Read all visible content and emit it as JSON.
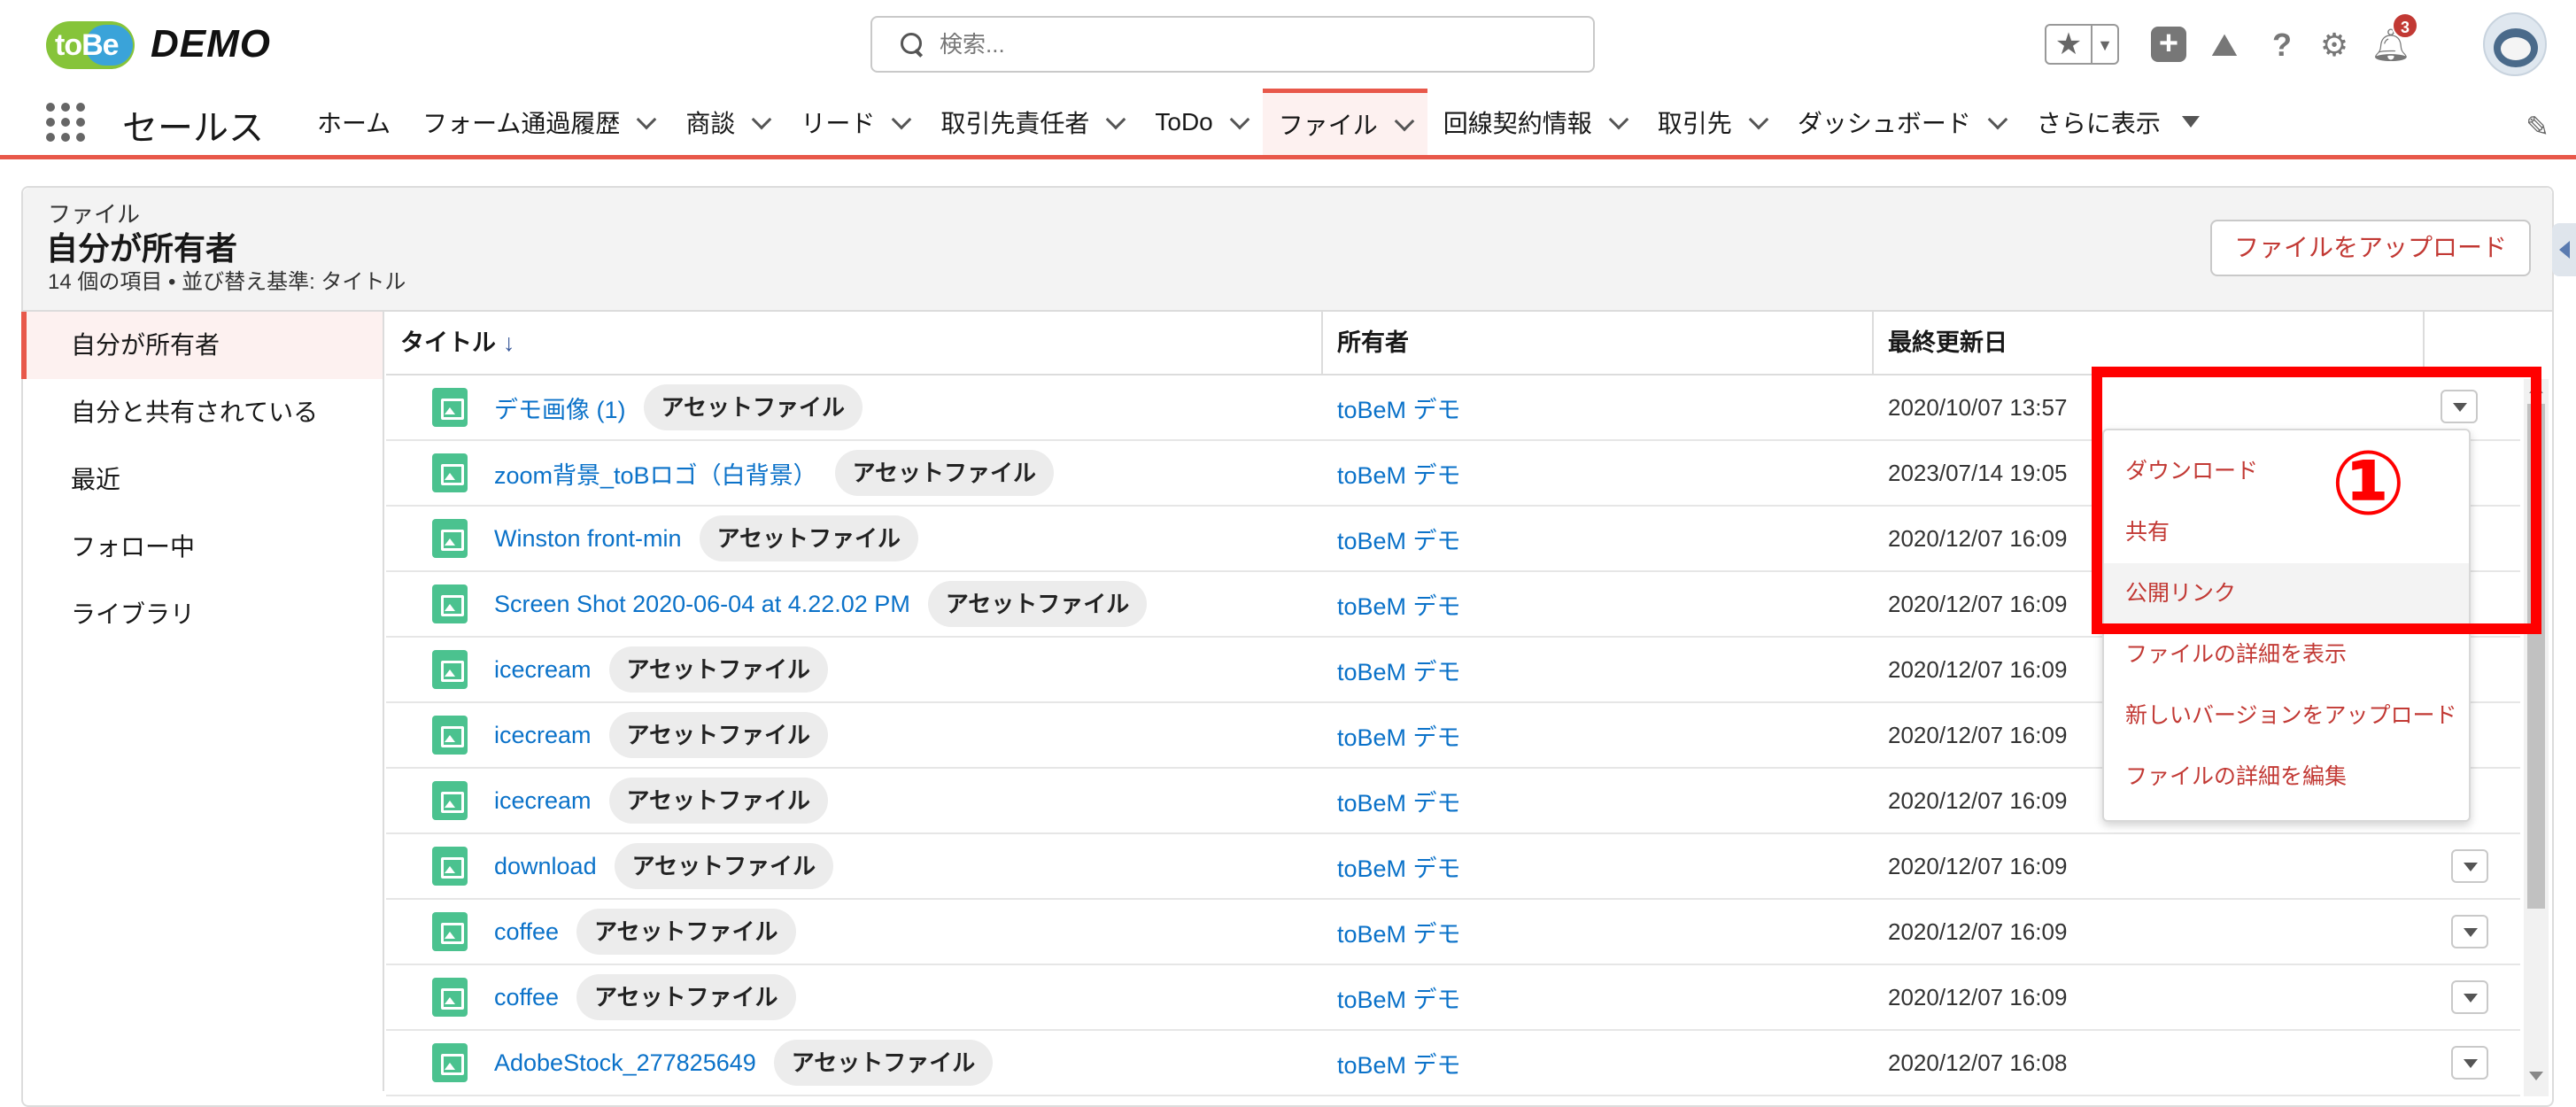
{
  "header": {
    "logo_badge": "toBe",
    "logo_text": "DEMO",
    "search_placeholder": "検索...",
    "notification_count": "3"
  },
  "nav": {
    "app_name": "セールス",
    "items": [
      {
        "label": "ホーム",
        "chevron": false
      },
      {
        "label": "フォーム通過履歴",
        "chevron": true
      },
      {
        "label": "商談",
        "chevron": true
      },
      {
        "label": "リード",
        "chevron": true
      },
      {
        "label": "取引先責任者",
        "chevron": true
      },
      {
        "label": "ToDo",
        "chevron": true
      },
      {
        "label": "ファイル",
        "chevron": true,
        "active": true
      },
      {
        "label": "回線契約情報",
        "chevron": true
      },
      {
        "label": "取引先",
        "chevron": true
      },
      {
        "label": "ダッシュボード",
        "chevron": true
      },
      {
        "label": "さらに表示",
        "chevron": false,
        "triangle": true
      }
    ]
  },
  "list": {
    "object_label": "ファイル",
    "title": "自分が所有者",
    "meta": "14 個の項目 • 並び替え基準: タイトル",
    "upload_button": "ファイルをアップロード"
  },
  "sidebar": {
    "items": [
      "自分が所有者",
      "自分と共有されている",
      "最近",
      "フォロー中",
      "ライブラリ"
    ],
    "active_index": 0
  },
  "table": {
    "columns": [
      "タイトル",
      "所有者",
      "最終更新日"
    ],
    "sort_indicator": "↓",
    "rows": [
      {
        "title": "デモ画像 (1)",
        "tag": "アセットファイル",
        "owner": "toBeM デモ",
        "updated": "2020/10/07 13:57"
      },
      {
        "title": "zoom背景_toBロゴ（白背景）",
        "tag": "アセットファイル",
        "owner": "toBeM デモ",
        "updated": "2023/07/14 19:05"
      },
      {
        "title": "Winston front-min",
        "tag": "アセットファイル",
        "owner": "toBeM デモ",
        "updated": "2020/12/07 16:09"
      },
      {
        "title": "Screen Shot 2020-06-04 at 4.22.02 PM",
        "tag": "アセットファイル",
        "owner": "toBeM デモ",
        "updated": "2020/12/07 16:09"
      },
      {
        "title": "icecream",
        "tag": "アセットファイル",
        "owner": "toBeM デモ",
        "updated": "2020/12/07 16:09"
      },
      {
        "title": "icecream",
        "tag": "アセットファイル",
        "owner": "toBeM デモ",
        "updated": "2020/12/07 16:09"
      },
      {
        "title": "icecream",
        "tag": "アセットファイル",
        "owner": "toBeM デモ",
        "updated": "2020/12/07 16:09"
      },
      {
        "title": "download",
        "tag": "アセットファイル",
        "owner": "toBeM デモ",
        "updated": "2020/12/07 16:09"
      },
      {
        "title": "coffee",
        "tag": "アセットファイル",
        "owner": "toBeM デモ",
        "updated": "2020/12/07 16:09"
      },
      {
        "title": "coffee",
        "tag": "アセットファイル",
        "owner": "toBeM デモ",
        "updated": "2020/12/07 16:09"
      },
      {
        "title": "AdobeStock_277825649",
        "tag": "アセットファイル",
        "owner": "toBeM デモ",
        "updated": "2020/12/07 16:08"
      }
    ]
  },
  "row_menu": {
    "items": [
      "ダウンロード",
      "共有",
      "公開リンク",
      "ファイルの詳細を表示",
      "新しいバージョンをアップロード",
      "ファイルの詳細を編集"
    ],
    "hovered_index": 2
  },
  "annotation": {
    "label": "①",
    "color": "#ff0000"
  },
  "colors": {
    "accent": "#e8584a",
    "link": "#0b72c9",
    "menu_text": "#c23934",
    "file_icon": "#4bc28f"
  }
}
